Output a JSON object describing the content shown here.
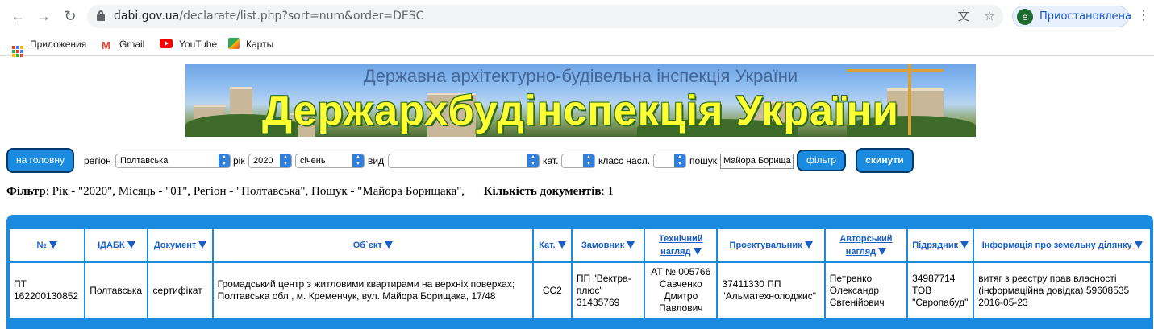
{
  "browser": {
    "url_host": "dabi.gov.ua",
    "url_path": "/declarate/list.php?sort=num&order=DESC",
    "profile_initial": "e",
    "profile_label": "Приостановлена",
    "bookmarks": [
      "Приложения",
      "Gmail",
      "YouTube",
      "Карты"
    ]
  },
  "banner": {
    "subtitle": "Державна архітектурно-будівельна інспекція України",
    "title": "Держархбудінспекція України"
  },
  "filters": {
    "home_button": "на головну",
    "region_label": "регіон",
    "region_value": "Полтавська",
    "year_label": "рік",
    "year_value": "2020",
    "month_value": "січень",
    "type_label": "вид",
    "type_value": "",
    "cat_label": "кат.",
    "cat_value": "",
    "class_label": "класс насл.",
    "class_value": "",
    "search_label": "пошук",
    "search_value": "Майора Борища",
    "filter_button": "фільтр",
    "reset_button": "скинути"
  },
  "summary": {
    "filter_label": "Фільтр",
    "filter_text": ": Рік - \"2020\", Місяць - \"01\", Регіон - \"Полтавська\", Пошук - \"Майора Борищака\",",
    "count_label": "Кількість документів",
    "count_value": ": 1"
  },
  "table": {
    "headers": [
      "№",
      "ІДАБК",
      "Документ",
      "Об`єкт",
      "Кат.",
      "Замовник",
      "Технічний нагляд",
      "Проектувальник",
      "Авторський нагляд",
      "Підрядник",
      "Інформація про земельну ділянку"
    ],
    "rows": [
      [
        "ПТ 162200130852",
        "Полтавська",
        "сертифікат",
        "Громадський центр з житловими квартирами на верхніх поверхах; Полтавська обл., м. Кременчук, вул. Майора Борищака, 17/48",
        "СС2",
        "ПП \"Вектра-плюс\" 31435769",
        "АТ № 005766 Савченко Дмитро Павлович",
        "37411330 ПП \"Альматехнолоджис\"",
        "Петренко Олександр Євгенійович",
        "34987714 ТОВ \"Європабуд\"",
        "витяг з реєстру прав власності (інформаційна довідка) 59608535 2016-05-23"
      ]
    ]
  }
}
